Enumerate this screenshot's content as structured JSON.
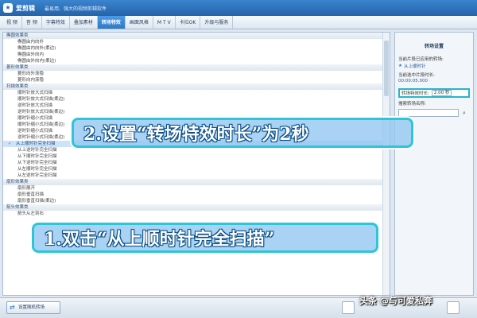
{
  "window": {
    "app_name": "爱剪辑",
    "slogan": "最易用、强大的视频剪辑软件"
  },
  "tabs": [
    {
      "label": "视 频"
    },
    {
      "label": "音 频"
    },
    {
      "label": "字幕特效"
    },
    {
      "label": "叠加素材"
    },
    {
      "label": "转场特效",
      "active": true
    },
    {
      "label": "画面风格"
    },
    {
      "label": "M T V"
    },
    {
      "label": "卡拉OK"
    },
    {
      "label": "升级与服务"
    }
  ],
  "transition_list": [
    {
      "type": "category",
      "label": "椭圆效果类"
    },
    {
      "type": "effect",
      "label": "椭圆由内向外"
    },
    {
      "type": "effect",
      "label": "椭圆由内向外(柔边)"
    },
    {
      "type": "effect",
      "label": "椭圆由外向内"
    },
    {
      "type": "effect",
      "label": "椭圆由外向内(柔边)"
    },
    {
      "type": "category",
      "label": "菱形效果类"
    },
    {
      "type": "effect",
      "label": "菱形向外渐隐"
    },
    {
      "type": "effect",
      "label": "菱形向内渐隐"
    },
    {
      "type": "category",
      "label": "扫描效果类"
    },
    {
      "type": "effect",
      "label": "顺时针放大式扫描"
    },
    {
      "type": "effect",
      "label": "顺时针放大式扫描(柔边)"
    },
    {
      "type": "effect",
      "label": "逆时针放大式扫描"
    },
    {
      "type": "effect",
      "label": "逆时针放大式扫描(柔边)"
    },
    {
      "type": "effect",
      "label": "顺时针缩小式扫描"
    },
    {
      "type": "effect",
      "label": "顺时针缩小式扫描(柔边)"
    },
    {
      "type": "effect",
      "label": "逆时针缩小式扫描"
    },
    {
      "type": "effect",
      "label": "逆时针缩小式扫描(柔边)"
    },
    {
      "type": "effect",
      "label": "从上顺时针完全扫描",
      "selected": true
    },
    {
      "type": "effect",
      "label": "从上逆时针完全扫描"
    },
    {
      "type": "effect",
      "label": "从下顺时针完全扫描"
    },
    {
      "type": "effect",
      "label": "从下逆时针完全扫描"
    },
    {
      "type": "effect",
      "label": "从左顺时针完全扫描"
    },
    {
      "type": "effect",
      "label": "从左逆时针完全扫描"
    },
    {
      "type": "category",
      "label": "扇形效果类"
    },
    {
      "type": "effect",
      "label": "扇形展开"
    },
    {
      "type": "effect",
      "label": "扇形垂直扫描"
    },
    {
      "type": "effect",
      "label": "扇形垂直扫描(柔边)"
    },
    {
      "type": "category",
      "label": "箭头效果类"
    },
    {
      "type": "effect",
      "label": "箭头从左到右"
    }
  ],
  "settings": {
    "title": "转场设置",
    "applied_label": "当前片段已应用的转场:",
    "applied_value": "从上顺时针",
    "position_label": "当前选中片段时长:",
    "position_value": "00:00:05.000",
    "duration_label": "转场特效时长:",
    "duration_value": "2.00 秒",
    "search_label": "搜索转场名称:",
    "search_value": ""
  },
  "bottom": {
    "random_button": "设置随机转场"
  },
  "annotations": {
    "step2": "2.设置“转场特效时长”为2秒",
    "step1": "1.双击“从上顺时针完全扫描”"
  },
  "watermark": "头条 @与可爱私奔",
  "colors": {
    "titlebar": "#2a6cb2",
    "active_tab": "#3a88d6",
    "callout_border": "#2cc6d6",
    "callout_fill": "#96c8f2"
  },
  "icons": {
    "search": "search-icon",
    "random": "shuffle-icon",
    "applied": "star-icon"
  }
}
